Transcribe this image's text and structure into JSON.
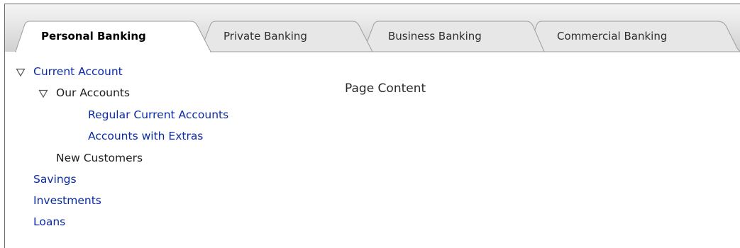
{
  "tabs": [
    {
      "label": "Personal Banking",
      "selected": true
    },
    {
      "label": "Private Banking",
      "selected": false
    },
    {
      "label": "Business Banking",
      "selected": false
    },
    {
      "label": "Commercial Banking",
      "selected": false
    }
  ],
  "nav": {
    "current_account": {
      "label": "Current Account",
      "expanded": true
    },
    "our_accounts": {
      "label": "Our Accounts",
      "expanded": true
    },
    "regular_current_accounts": "Regular Current Accounts",
    "accounts_with_extras": "Accounts with Extras",
    "new_customers": "New Customers",
    "savings": "Savings",
    "investments": "Investments",
    "loans": "Loans"
  },
  "main": {
    "content": "Page Content"
  },
  "colors": {
    "link": "#0a2aa3",
    "tab_bg": "#e3e3e3",
    "selected_tab_bg": "#ffffff"
  }
}
